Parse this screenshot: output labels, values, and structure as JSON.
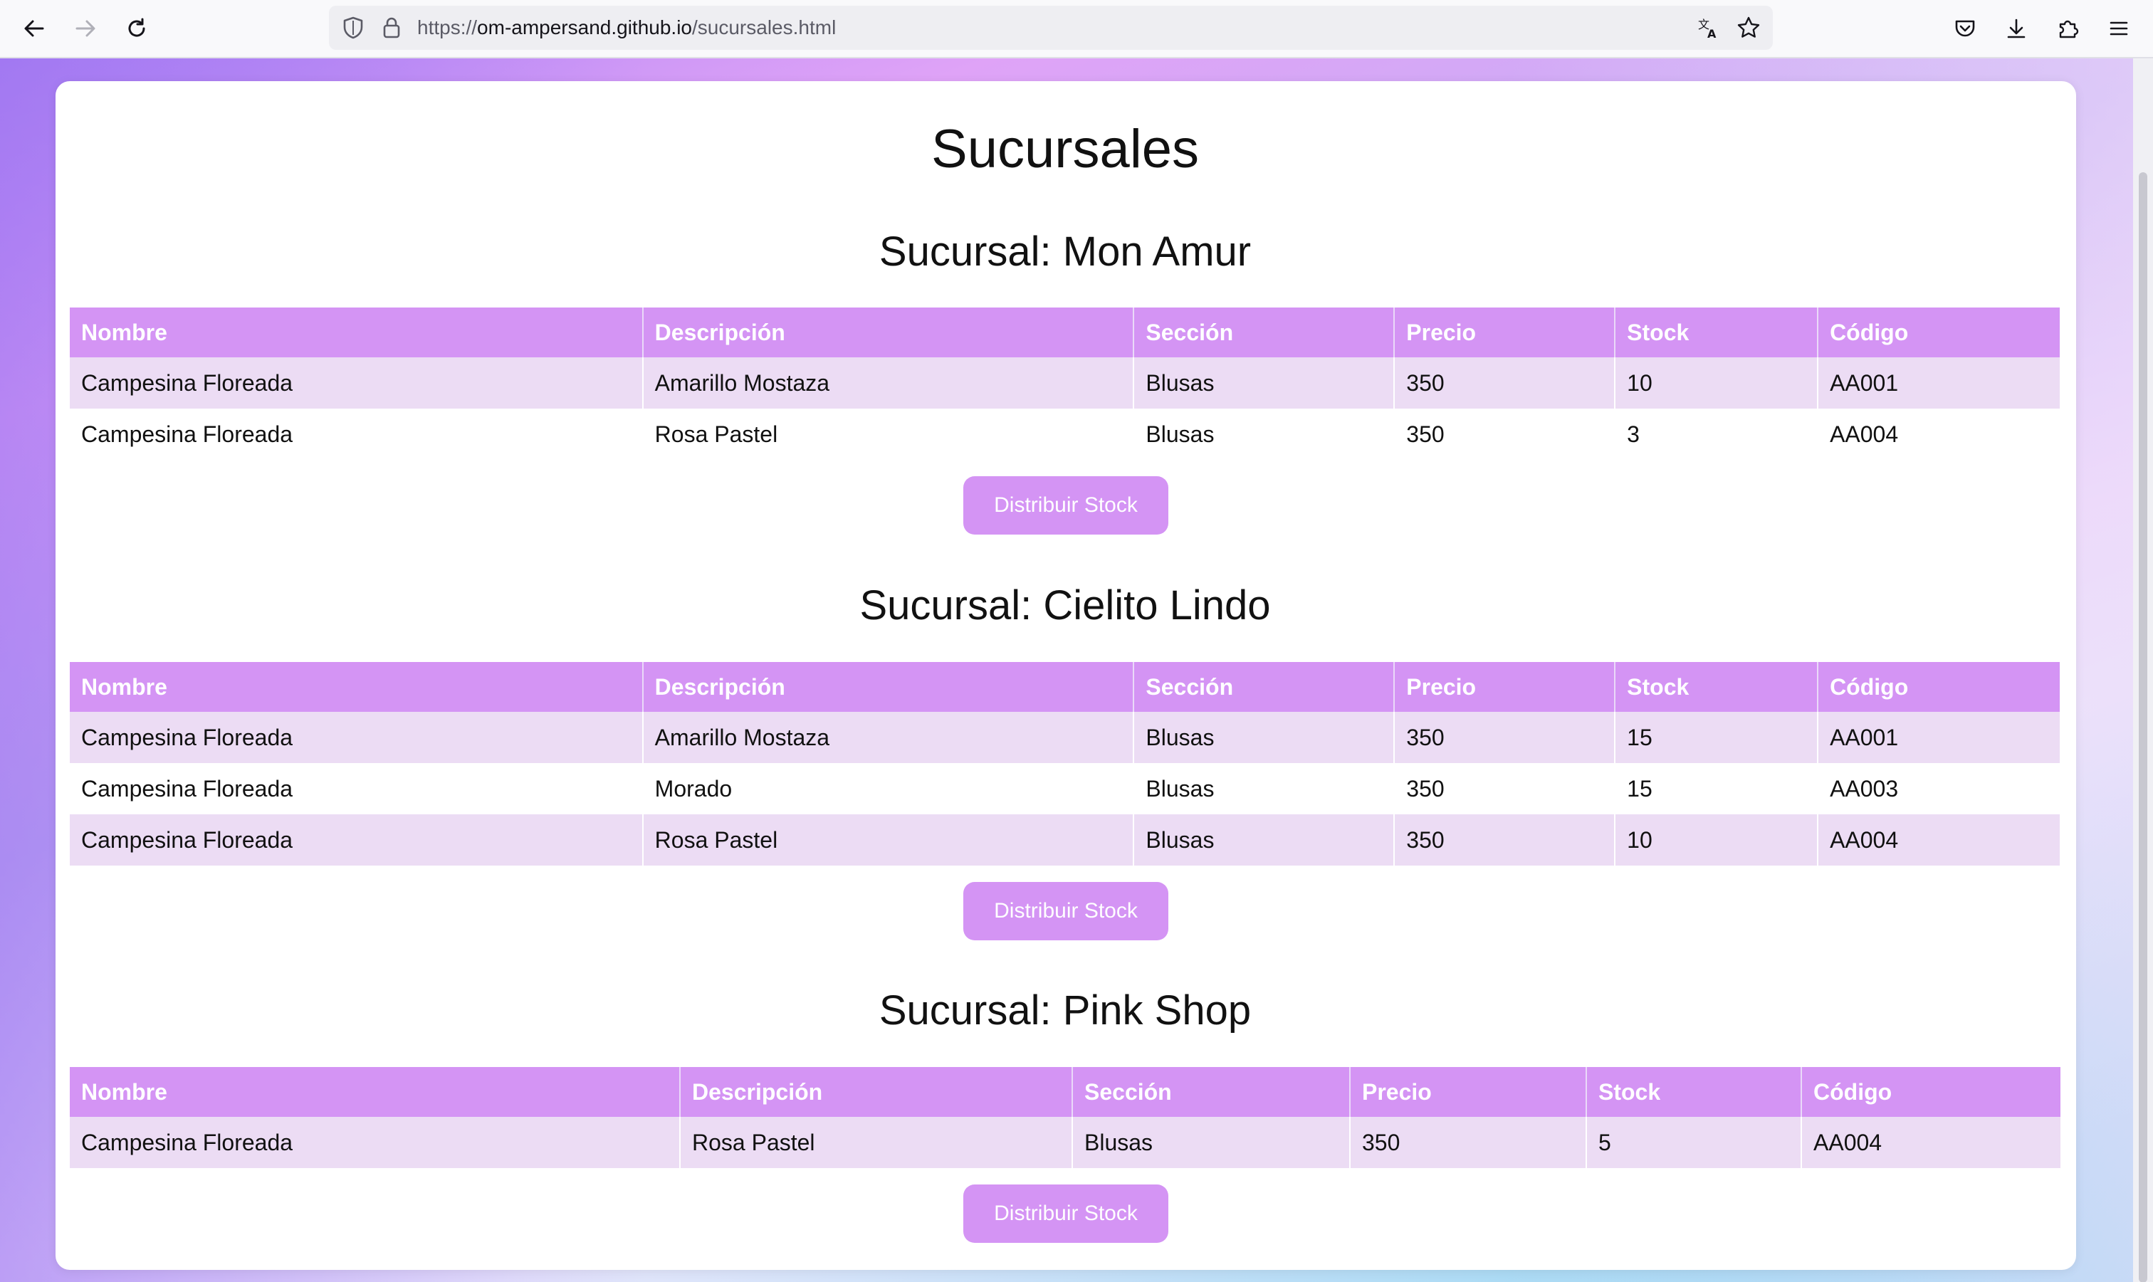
{
  "browser": {
    "url_prefix": "https://",
    "url_host": "om-ampersand.github.io",
    "url_path": "/sucursales.html"
  },
  "page": {
    "title": "Sucursales"
  },
  "columns": [
    "Nombre",
    "Descripción",
    "Sección",
    "Precio",
    "Stock",
    "Código"
  ],
  "branches": [
    {
      "title": "Sucursal: Mon Amur",
      "button": "Distribuir Stock",
      "rows": [
        [
          "Campesina Floreada",
          "Amarillo Mostaza",
          "Blusas",
          "350",
          "10",
          "AA001"
        ],
        [
          "Campesina Floreada",
          "Rosa Pastel",
          "Blusas",
          "350",
          "3",
          "AA004"
        ]
      ]
    },
    {
      "title": "Sucursal: Cielito Lindo",
      "button": "Distribuir Stock",
      "rows": [
        [
          "Campesina Floreada",
          "Amarillo Mostaza",
          "Blusas",
          "350",
          "15",
          "AA001"
        ],
        [
          "Campesina Floreada",
          "Morado",
          "Blusas",
          "350",
          "15",
          "AA003"
        ],
        [
          "Campesina Floreada",
          "Rosa Pastel",
          "Blusas",
          "350",
          "10",
          "AA004"
        ]
      ]
    },
    {
      "title": "Sucursal: Pink Shop",
      "button": "Distribuir Stock",
      "rows": [
        [
          "Campesina Floreada",
          "Rosa Pastel",
          "Blusas",
          "350",
          "5",
          "AA004"
        ]
      ]
    }
  ],
  "colors": {
    "accent": "#d494f4",
    "row_stripe": "#ecdcf4"
  }
}
